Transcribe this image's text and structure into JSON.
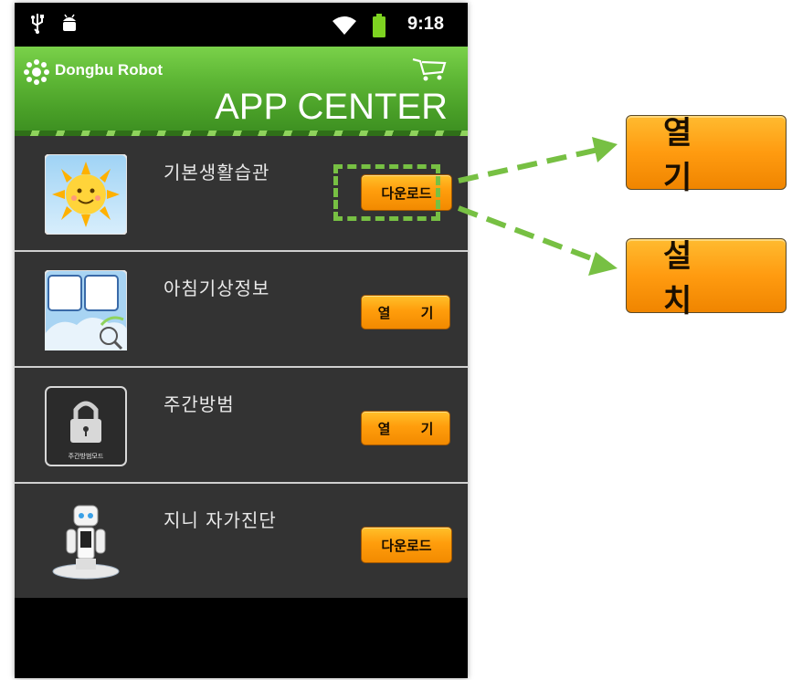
{
  "status_bar": {
    "time": "9:18"
  },
  "header": {
    "brand": "Dongbu Robot",
    "title": "APP CENTER"
  },
  "apps": [
    {
      "name": "기본생활습관",
      "action": "다운로드",
      "icon": "sun-icon"
    },
    {
      "name": "아침기상정보",
      "action": "열 기",
      "icon": "weather-clock-icon"
    },
    {
      "name": "주간방범",
      "action": "열 기",
      "icon": "lock-icon",
      "icon_caption": "주간방범모드"
    },
    {
      "name": "지니 자가진단",
      "action": "다운로드",
      "icon": "robot-icon"
    }
  ],
  "callouts": {
    "open_label": "열 기",
    "install_label": "설 치"
  },
  "colors": {
    "header_green": "#5fb836",
    "button_orange": "#ff9d0c",
    "list_bg": "#333333",
    "highlight_green": "#77c043"
  }
}
